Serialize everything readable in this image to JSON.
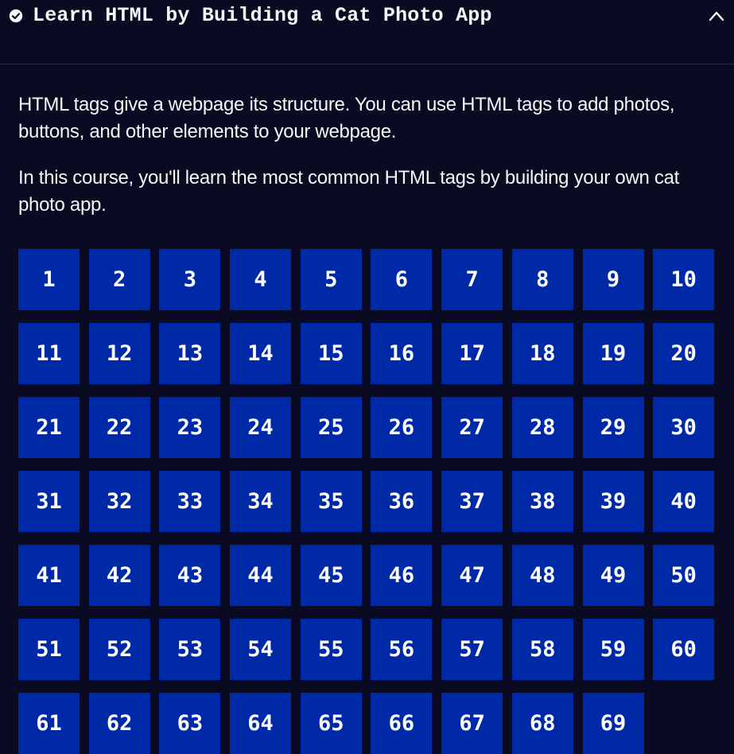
{
  "header": {
    "title": "Learn HTML by Building a Cat Photo App",
    "status_icon": "check-circle-icon",
    "toggle_icon": "chevron-up-icon"
  },
  "intro": {
    "paragraph_1": "HTML tags give a webpage its structure. You can use HTML tags to add photos, buttons, and other elements to your webpage.",
    "paragraph_2": "In this course, you'll learn the most common HTML tags by building your own cat photo app."
  },
  "steps": [
    "1",
    "2",
    "3",
    "4",
    "5",
    "6",
    "7",
    "8",
    "9",
    "10",
    "11",
    "12",
    "13",
    "14",
    "15",
    "16",
    "17",
    "18",
    "19",
    "20",
    "21",
    "22",
    "23",
    "24",
    "25",
    "26",
    "27",
    "28",
    "29",
    "30",
    "31",
    "32",
    "33",
    "34",
    "35",
    "36",
    "37",
    "38",
    "39",
    "40",
    "41",
    "42",
    "43",
    "44",
    "45",
    "46",
    "47",
    "48",
    "49",
    "50",
    "51",
    "52",
    "53",
    "54",
    "55",
    "56",
    "57",
    "58",
    "59",
    "60",
    "61",
    "62",
    "63",
    "64",
    "65",
    "66",
    "67",
    "68",
    "69"
  ],
  "colors": {
    "background": "#0a0a23",
    "step_button": "#0029a8",
    "text": "#f5f6f7"
  }
}
